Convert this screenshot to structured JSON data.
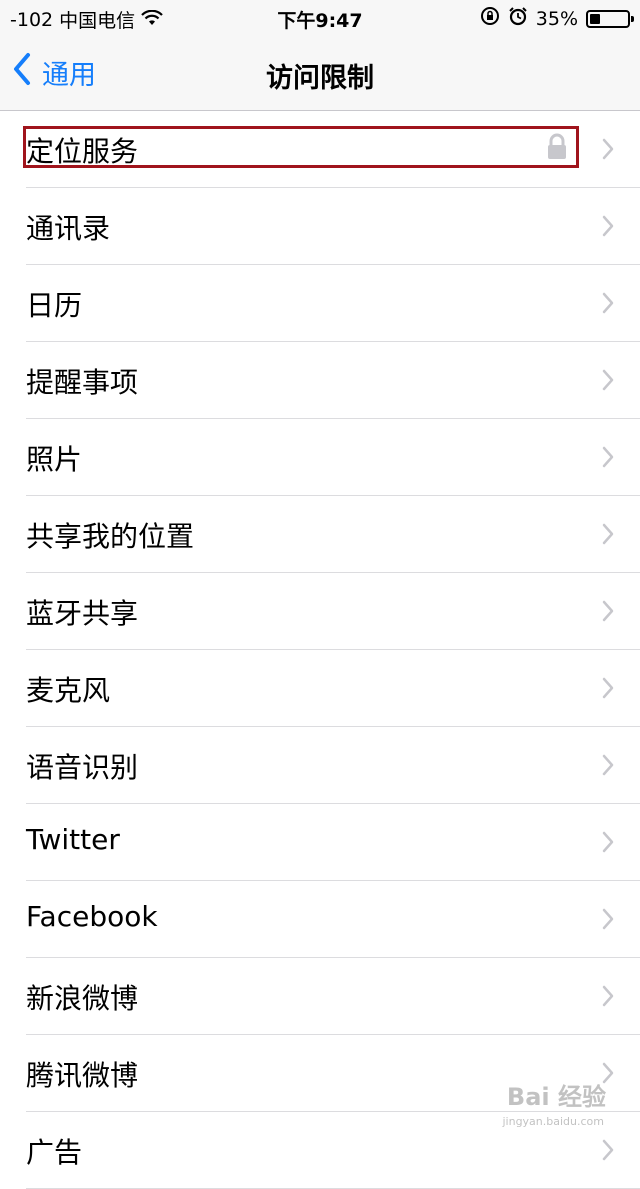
{
  "status_bar": {
    "signal": "-102",
    "carrier": "中国电信",
    "time": "下午9:47",
    "battery": "35%",
    "battery_level": 0.35
  },
  "nav": {
    "back_label": "通用",
    "title": "访问限制"
  },
  "rows": [
    {
      "label": "定位服务"
    },
    {
      "label": "通讯录"
    },
    {
      "label": "日历"
    },
    {
      "label": "提醒事项"
    },
    {
      "label": "照片"
    },
    {
      "label": "共享我的位置"
    },
    {
      "label": "蓝牙共享"
    },
    {
      "label": "麦克风"
    },
    {
      "label": "语音识别"
    },
    {
      "label": "Twitter"
    },
    {
      "label": "Facebook"
    },
    {
      "label": "新浪微博"
    },
    {
      "label": "腾讯微博"
    },
    {
      "label": "广告"
    }
  ],
  "watermark": {
    "text": "Bai 经验",
    "sub": "jingyan.baidu.com"
  },
  "colors": {
    "accent": "#157efb",
    "highlight_border": "#a0141c"
  }
}
